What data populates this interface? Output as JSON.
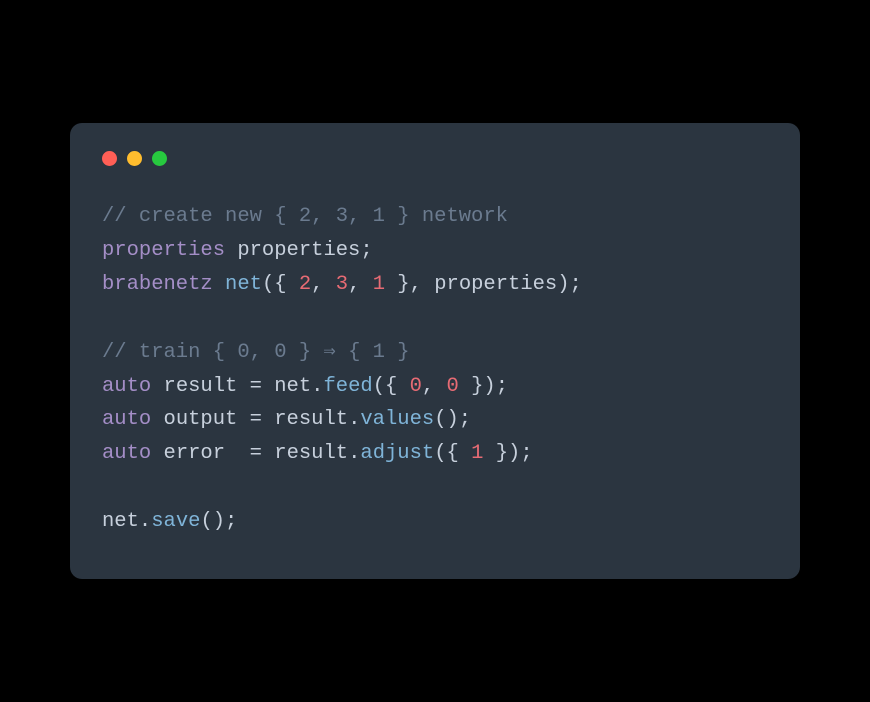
{
  "code": {
    "line1": {
      "comment": "// create new { 2, 3, 1 } network"
    },
    "line2": {
      "type": "properties",
      "var": " properties",
      "semi": ";"
    },
    "line3": {
      "type": "brabenetz",
      "space1": " ",
      "func": "net",
      "open": "({ ",
      "n1": "2",
      "c1": ", ",
      "n2": "3",
      "c2": ", ",
      "n3": "1",
      "close1": " }, ",
      "arg2": "properties",
      "close2": ");"
    },
    "line4": {
      "comment": "// train { 0, 0 } ⇒ { 1 }"
    },
    "line5": {
      "kw": "auto",
      "sp1": " ",
      "var": "result",
      "eq": " = ",
      "obj": "net",
      "dot": ".",
      "method": "feed",
      "open": "({ ",
      "n1": "0",
      "c1": ", ",
      "n2": "0",
      "close": " });"
    },
    "line6": {
      "kw": "auto",
      "sp1": " ",
      "var": "output",
      "eq": " = ",
      "obj": "result",
      "dot": ".",
      "method": "values",
      "call": "();"
    },
    "line7": {
      "kw": "auto",
      "sp1": " ",
      "var": "error",
      "eq": "  = ",
      "obj": "result",
      "dot": ".",
      "method": "adjust",
      "open": "({ ",
      "n1": "1",
      "close": " });"
    },
    "line8": {
      "obj": "net",
      "dot": ".",
      "method": "save",
      "call": "();"
    }
  }
}
